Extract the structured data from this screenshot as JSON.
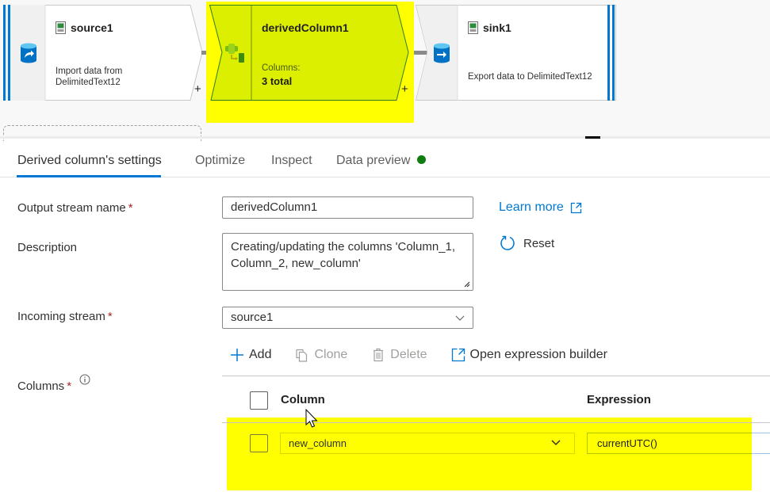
{
  "graph": {
    "nodes": [
      {
        "id": "source1",
        "title": "source1",
        "type_icon": "database-import-icon",
        "file_icon": "csv-file-icon",
        "description_lines": [
          "Import data from",
          "DelimitedText12"
        ],
        "add_label": "+"
      },
      {
        "id": "derivedColumn1",
        "title": "derivedColumn1",
        "type_icon": "derived-column-icon",
        "subtitle": "Columns:",
        "detail": "3 total",
        "add_label": "+",
        "selected": true
      },
      {
        "id": "sink1",
        "title": "sink1",
        "type_icon": "database-export-icon",
        "file_icon": "csv-file-icon",
        "description_lines": [
          "Export data to DelimitedText12"
        ]
      }
    ]
  },
  "tabs": [
    {
      "label": "Derived column's settings",
      "active": true
    },
    {
      "label": "Optimize",
      "active": false
    },
    {
      "label": "Inspect",
      "active": false
    },
    {
      "label": "Data preview",
      "active": false,
      "status": "green-dot",
      "status_color": "#107c10"
    }
  ],
  "form": {
    "output_stream": {
      "label": "Output stream name",
      "required_mark": "*",
      "value": "derivedColumn1"
    },
    "description": {
      "label": "Description",
      "value": "Creating/updating the columns 'Column_1, Column_2, new_column'"
    },
    "incoming_stream": {
      "label": "Incoming stream",
      "required_mark": "*",
      "value": "source1"
    },
    "columns": {
      "label": "Columns",
      "required_mark": "*",
      "info_icon": "info-icon"
    },
    "learn_more": "Learn more",
    "reset": "Reset"
  },
  "toolbar": {
    "add": "Add",
    "clone": "Clone",
    "delete": "Delete",
    "open_builder": "Open expression builder"
  },
  "table": {
    "headers": {
      "column": "Column",
      "expression": "Expression"
    },
    "rows": [
      {
        "column": "new_column",
        "expression": "currentUTC()"
      }
    ]
  },
  "colors": {
    "accent": "#0078d4",
    "highlight": "#ffff00",
    "selected_node": "#dcef00",
    "required": "#a4262c"
  }
}
